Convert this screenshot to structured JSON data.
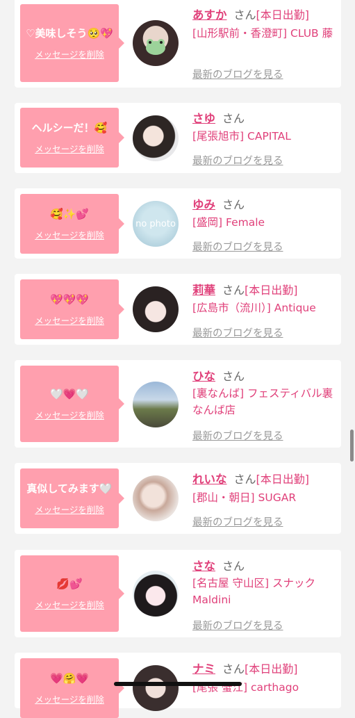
{
  "colors": {
    "accent": "#e0407a",
    "message_bg": "#ff9fae",
    "link_gray": "#999999"
  },
  "common": {
    "san": "さん",
    "delete_label": "メッセージを削除",
    "blog_label": "最新のブログを見る"
  },
  "entries": [
    {
      "name": "あすか",
      "attendance": "[本日出勤]",
      "shop": "[山形駅前・香澄町] CLUB 藤",
      "message": "♡美味しそう🥺💖"
    },
    {
      "name": "さゆ",
      "attendance": "",
      "shop": "[尾張旭市] CAPITAL",
      "message": "ヘルシーだ！🥰"
    },
    {
      "name": "ゆみ",
      "attendance": "",
      "shop": "[盛岡] Female",
      "message": "🥰✨💕"
    },
    {
      "name": "莉華",
      "attendance": "[本日出勤]",
      "shop": "[広島市（流川）] Antique",
      "message": "💖💖💖"
    },
    {
      "name": "ひな",
      "attendance": "",
      "shop": "[裏なんば] フェスティバル裏なんば店",
      "message": "🤍💗🤍"
    },
    {
      "name": "れいな",
      "attendance": "[本日出勤]",
      "shop": "[郡山・朝日] SUGAR",
      "message": "真似してみます🤍"
    },
    {
      "name": "さな",
      "attendance": "",
      "shop": "[名古屋 守山区] スナック Maldini",
      "message": "💋💕"
    },
    {
      "name": "ナミ",
      "attendance": "[本日出勤]",
      "shop": "[尾張 蟹江] carthago",
      "message": "💗🤗💗"
    }
  ],
  "placeholder_avatar_text": "no photo"
}
